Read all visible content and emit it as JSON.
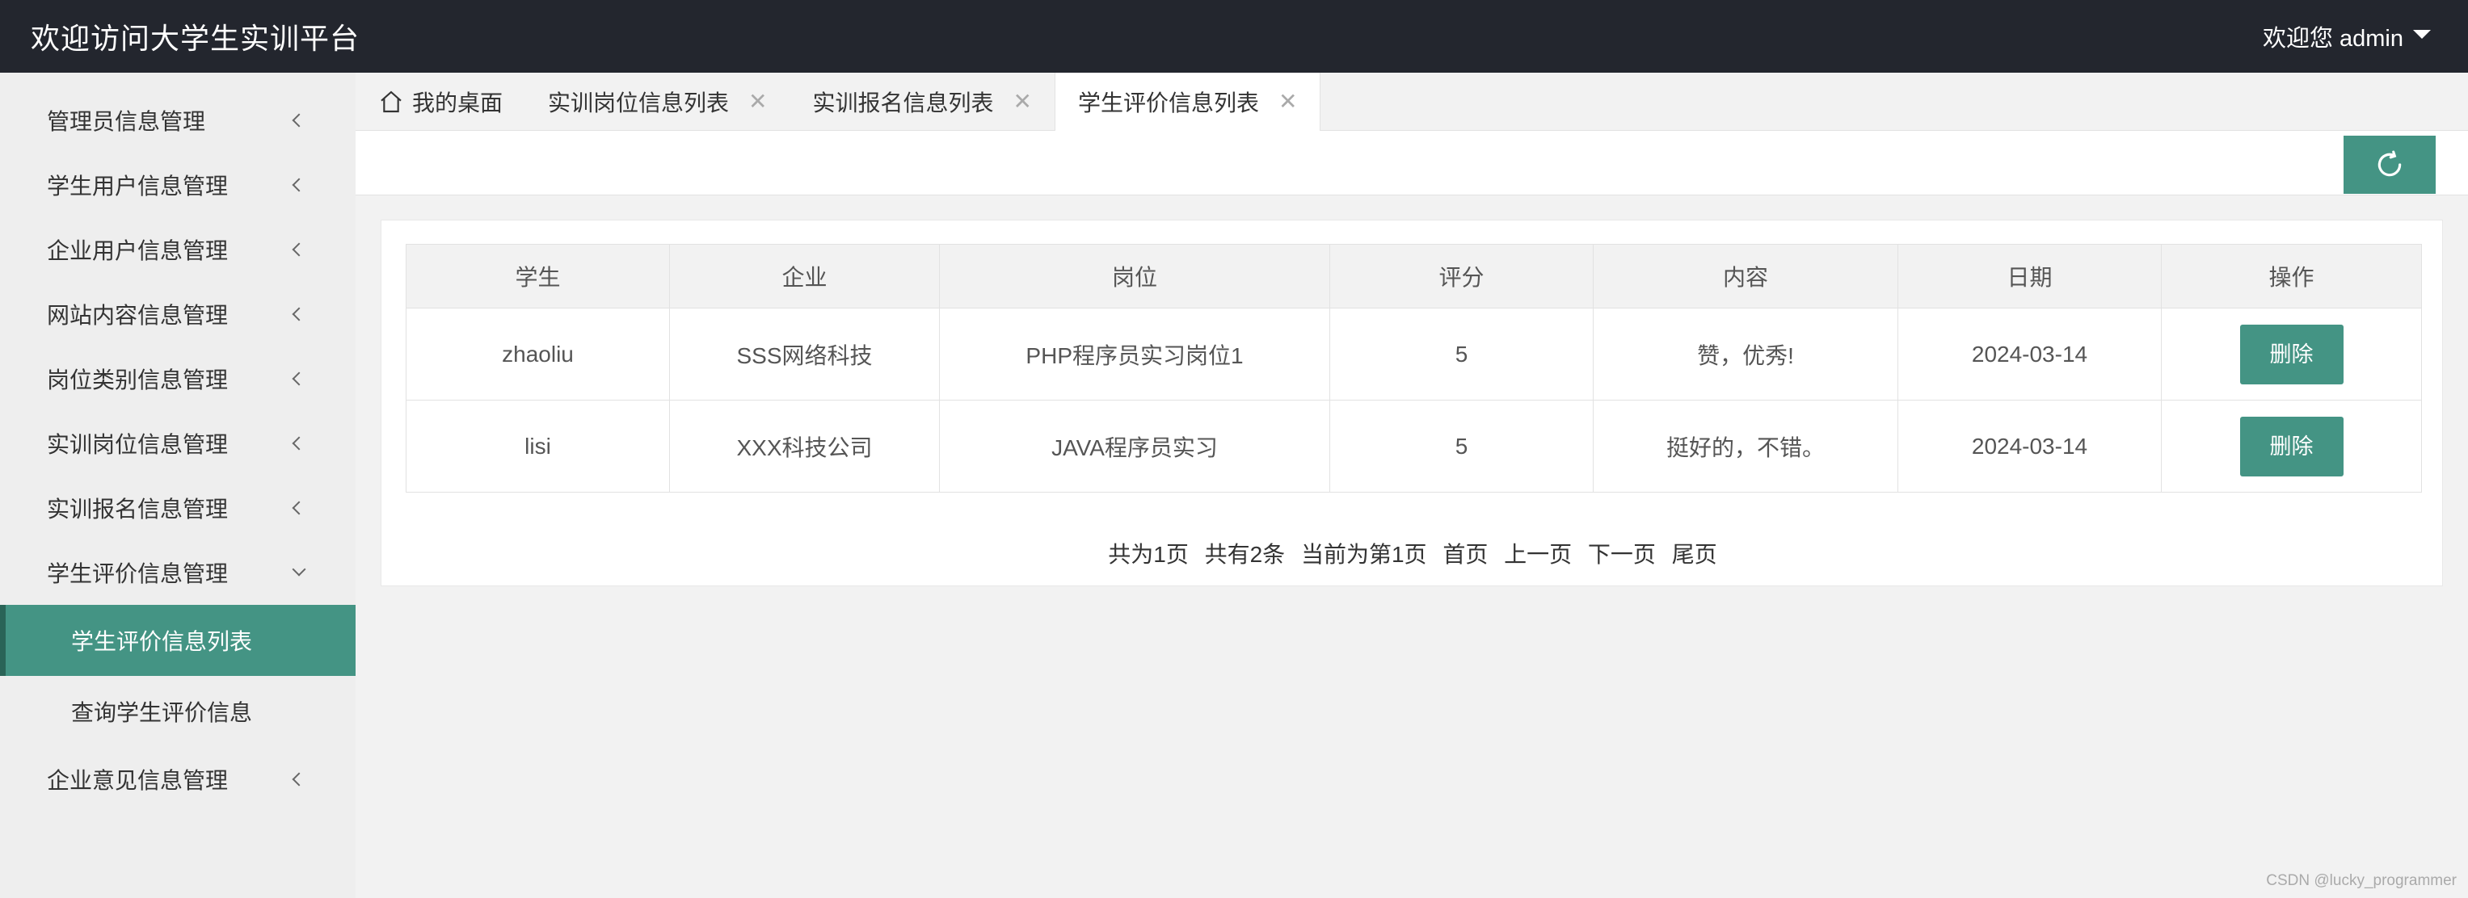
{
  "header": {
    "title": "欢迎访问大学生实训平台",
    "user_greeting": "欢迎您 admin"
  },
  "sidebar": {
    "items": [
      {
        "label": "管理员信息管理"
      },
      {
        "label": "学生用户信息管理"
      },
      {
        "label": "企业用户信息管理"
      },
      {
        "label": "网站内容信息管理"
      },
      {
        "label": "岗位类别信息管理"
      },
      {
        "label": "实训岗位信息管理"
      },
      {
        "label": "实训报名信息管理"
      },
      {
        "label": "学生评价信息管理"
      }
    ],
    "subitems": [
      {
        "label": "学生评价信息列表"
      },
      {
        "label": "查询学生评价信息"
      }
    ],
    "last_item": {
      "label": "企业意见信息管理"
    }
  },
  "tabs": [
    {
      "label": "我的桌面"
    },
    {
      "label": "实训岗位信息列表"
    },
    {
      "label": "实训报名信息列表"
    },
    {
      "label": "学生评价信息列表"
    }
  ],
  "table": {
    "headers": [
      "学生",
      "企业",
      "岗位",
      "评分",
      "内容",
      "日期",
      "操作"
    ],
    "rows": [
      {
        "student": "zhaoliu",
        "company": "SSS网络科技",
        "position": "PHP程序员实习岗位1",
        "score": "5",
        "content": "赞，优秀!",
        "date": "2024-03-14",
        "action": "删除"
      },
      {
        "student": "lisi",
        "company": "XXX科技公司",
        "position": "JAVA程序员实习",
        "score": "5",
        "content": "挺好的，不错。",
        "date": "2024-03-14",
        "action": "删除"
      }
    ]
  },
  "pager": {
    "total_pages": "共为1页",
    "total_items": "共有2条",
    "current": "当前为第1页",
    "first": "首页",
    "prev": "上一页",
    "next": "下一页",
    "last": "尾页"
  },
  "watermark": "CSDN @lucky_programmer",
  "colors": {
    "header_bg": "#23262e",
    "accent": "#449484",
    "sidebar_bg": "#eeeeee"
  },
  "icons": {
    "home": "home-icon",
    "refresh": "refresh-icon",
    "close": "close-icon",
    "caret": "caret-down-icon",
    "chevron": "chevron-left-icon"
  }
}
